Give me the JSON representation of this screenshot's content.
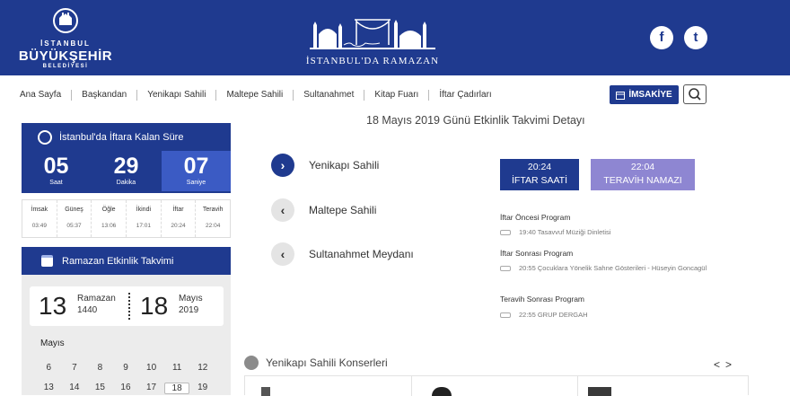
{
  "header": {
    "ibb_logo": {
      "line1": "İSTANBUL",
      "line2": "BÜYÜKŞEHİR",
      "line3": "BELEDİYESİ"
    },
    "site_title": "İSTANBUL'DA RAMAZAN",
    "social": {
      "facebook": "f",
      "twitter": "t"
    }
  },
  "nav": {
    "items": [
      "Ana Sayfa",
      "Başkandan",
      "Yenikapı Sahili",
      "Maltepe Sahili",
      "Sultanahmet",
      "Kitap Fuarı",
      "İftar Çadırları"
    ],
    "imsakiye_label": "İMSAKİYE"
  },
  "countdown": {
    "title": "İstanbul'da İftara Kalan Süre",
    "hours": "05",
    "hours_label": "Saat",
    "minutes": "29",
    "minutes_label": "Dakika",
    "seconds": "07",
    "seconds_label": "Saniye"
  },
  "prayer_times": [
    {
      "name": "İmsak",
      "time": "03:49"
    },
    {
      "name": "Güneş",
      "time": "05:37"
    },
    {
      "name": "Öğle",
      "time": "13:06"
    },
    {
      "name": "İkindi",
      "time": "17:01"
    },
    {
      "name": "İftar",
      "time": "20:24"
    },
    {
      "name": "Teravih",
      "time": "22:04"
    }
  ],
  "calendar": {
    "title": "Ramazan Etkinlik Takvimi",
    "hijri_day": "13",
    "hijri_month": "Ramazan",
    "hijri_year": "1440",
    "greg_day": "18",
    "greg_month": "Mayıs",
    "greg_year": "2019",
    "month_label": "Mayıs",
    "row1": [
      "6",
      "7",
      "8",
      "9",
      "10",
      "11",
      "12"
    ],
    "row2": [
      "13",
      "14",
      "15",
      "16",
      "17",
      "18",
      "19"
    ]
  },
  "main": {
    "title": "18 Mayıs 2019 Günü Etkinlik Takvimi Detayı",
    "venues": [
      {
        "name": "Yenikapı Sahili",
        "arrow": "›"
      },
      {
        "name": "Maltepe Sahili",
        "arrow": "‹"
      },
      {
        "name": "Sultanahmet Meydanı",
        "arrow": "‹"
      }
    ],
    "iftar": {
      "time": "20:24",
      "label": "İFTAR SAATİ"
    },
    "teravih": {
      "time": "22:04",
      "label": "TERAVİH NAMAZI"
    },
    "programs": [
      {
        "heading": "İftar Öncesi Program",
        "item": "19:40 Tasavvuf Müziği Dinletisi"
      },
      {
        "heading": "İftar Sonrası Program",
        "item": "20:55 Çocuklara Yönelik Sahne Gösterileri - Hüseyin Goncagül"
      },
      {
        "heading": "Teravih Sonrası Program",
        "item": "22:55 GRUP DERGAH"
      }
    ]
  },
  "concerts": {
    "title": "Yenikapı Sahili Konserleri",
    "prev": "<",
    "next": ">"
  },
  "colors": {
    "brand": "#1f3a8f",
    "teravih": "#8e86d2",
    "calendar_bg": "#ececec"
  }
}
